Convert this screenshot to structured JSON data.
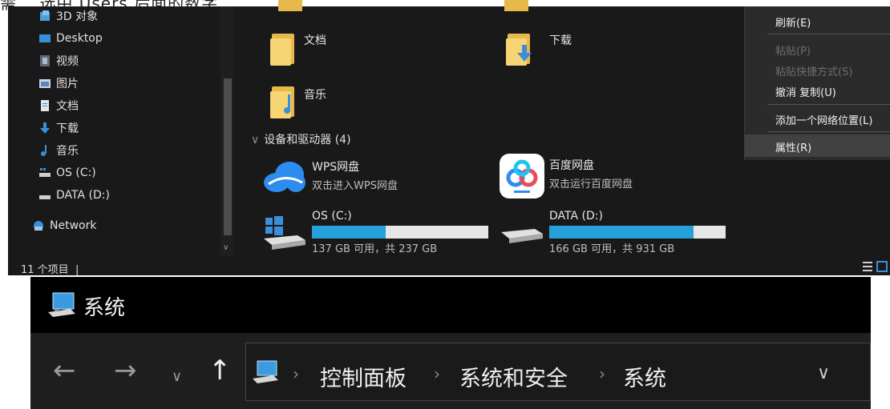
{
  "cut_caption": "需… 选中 Users 后面的数字",
  "nav": {
    "items": [
      {
        "label": "3D 对象",
        "icon": "3d-objects-icon"
      },
      {
        "label": "Desktop",
        "icon": "desktop-icon"
      },
      {
        "label": "视频",
        "icon": "videos-icon"
      },
      {
        "label": "图片",
        "icon": "pictures-icon"
      },
      {
        "label": "文档",
        "icon": "documents-icon"
      },
      {
        "label": "下载",
        "icon": "downloads-icon"
      },
      {
        "label": "音乐",
        "icon": "music-icon"
      },
      {
        "label": "OS (C:)",
        "icon": "os-drive-icon"
      },
      {
        "label": "DATA (D:)",
        "icon": "data-drive-icon"
      },
      {
        "label": "Network",
        "icon": "network-icon"
      }
    ]
  },
  "main": {
    "folders": [
      {
        "label": "文档"
      },
      {
        "label": "下载"
      },
      {
        "label": "音乐"
      }
    ],
    "devices_header": "设备和驱动器 (4)",
    "apps": [
      {
        "name": "WPS网盘",
        "desc": "双击进入WPS网盘"
      },
      {
        "name": "百度网盘",
        "desc": "双击运行百度网盘"
      }
    ],
    "drives": [
      {
        "name": "OS (C:)",
        "free_text": "137 GB 可用，共 237 GB",
        "used_fraction": 0.42
      },
      {
        "name": "DATA (D:)",
        "free_text": "166 GB 可用，共 931 GB",
        "used_fraction": 0.82
      }
    ]
  },
  "context_menu": {
    "items": [
      {
        "label": "刷新(E)",
        "disabled": false
      },
      {
        "label": "粘贴(P)",
        "disabled": true
      },
      {
        "label": "粘贴快捷方式(S)",
        "disabled": true
      },
      {
        "label": "撤消 复制(U)",
        "disabled": false
      },
      {
        "label": "添加一个网络位置(L)",
        "disabled": false
      },
      {
        "label": "属性(R)",
        "disabled": false
      }
    ]
  },
  "status": {
    "count_text": "11 个项目"
  },
  "system_window": {
    "title": "系统",
    "breadcrumb": [
      "控制面板",
      "系统和安全",
      "系统"
    ]
  },
  "colors": {
    "accent": "#26a0da",
    "background": "#191919",
    "folder": "#f7d474"
  }
}
